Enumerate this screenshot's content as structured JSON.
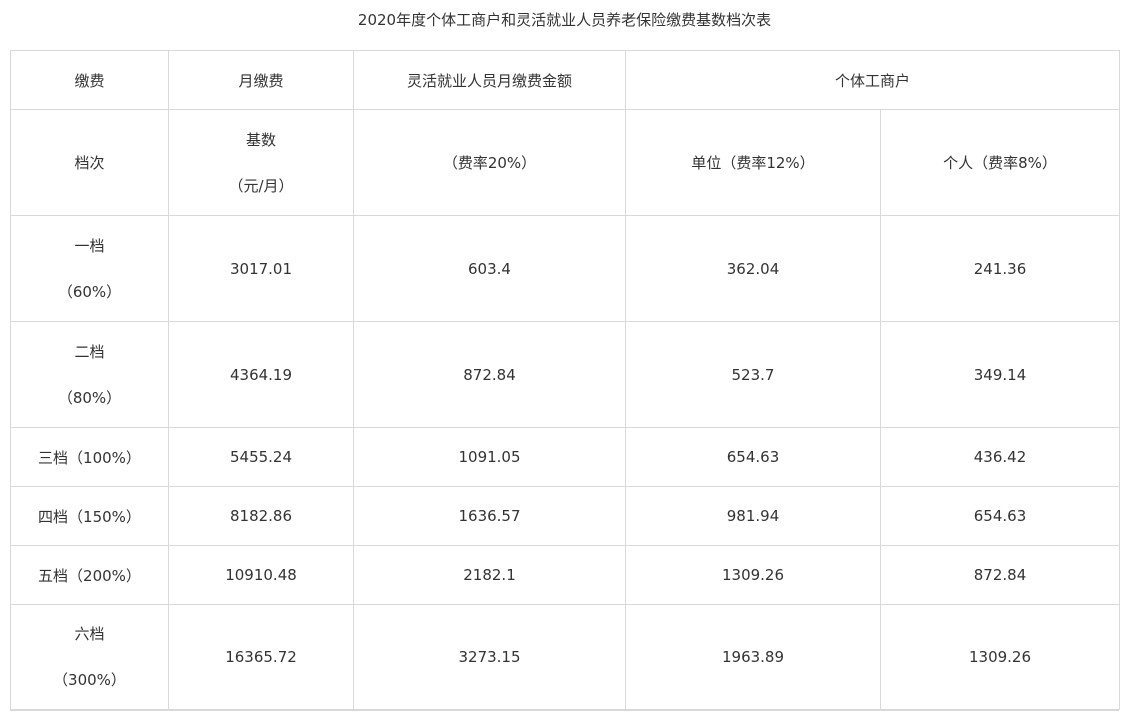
{
  "title": "2020年度个体工商户和灵活就业人员养老保险缴费基数档次表",
  "header": {
    "col1_row1": "缴费",
    "col1_row2": "档次",
    "col2_row1": "月缴费",
    "col2_row2_line1": "基数",
    "col2_row2_line2": "（元/月）",
    "col3_row1": "灵活就业人员月缴费金额",
    "col3_row2": "（费率20%）",
    "group_label": "个体工商户",
    "unit_label": "单位（费率12%）",
    "personal_label": "个人（费率8%）"
  },
  "rows": [
    {
      "tier_line1": "一档",
      "tier_line2": "（60%）",
      "base": "3017.01",
      "flex": "603.4",
      "unit": "362.04",
      "personal": "241.36"
    },
    {
      "tier_line1": "二档",
      "tier_line2": "（80%）",
      "base": "4364.19",
      "flex": "872.84",
      "unit": "523.7",
      "personal": "349.14"
    },
    {
      "tier_line1": "三档（100%）",
      "tier_line2": "",
      "base": "5455.24",
      "flex": "1091.05",
      "unit": "654.63",
      "personal": "436.42"
    },
    {
      "tier_line1": "四档（150%）",
      "tier_line2": "",
      "base": "8182.86",
      "flex": "1636.57",
      "unit": "981.94",
      "personal": "654.63"
    },
    {
      "tier_line1": "五档（200%）",
      "tier_line2": "",
      "base": "10910.48",
      "flex": "2182.1",
      "unit": "1309.26",
      "personal": "872.84"
    },
    {
      "tier_line1": "六档",
      "tier_line2": "（300%）",
      "base": "16365.72",
      "flex": "3273.15",
      "unit": "1963.89",
      "personal": "1309.26"
    }
  ]
}
